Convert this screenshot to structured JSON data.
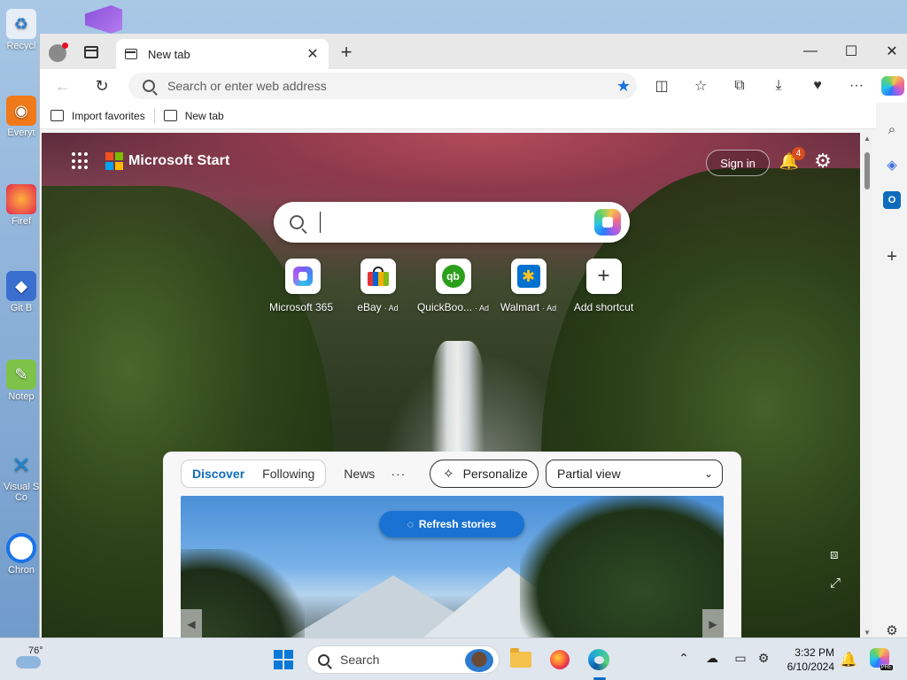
{
  "desktop": {
    "icons": [
      {
        "label": "Recycl",
        "icon": "recycle-bin-icon"
      },
      {
        "label": "Everyt",
        "icon": "everything-icon"
      },
      {
        "label": "Firef",
        "icon": "firefox-icon"
      },
      {
        "label": "Git B",
        "icon": "git-bash-icon"
      },
      {
        "label": "Notep",
        "icon": "notepad-icon"
      },
      {
        "label": "Visual S",
        "icon": "visual-studio-code-icon"
      },
      {
        "label": "Co",
        "icon": "vscode-label-icon"
      },
      {
        "label": "Chron",
        "icon": "chrome-icon"
      }
    ]
  },
  "browser": {
    "tab_title": "New tab",
    "address_placeholder": "Search or enter web address",
    "favorites_bar": {
      "import_label": "Import favorites",
      "new_tab_label": "New tab"
    },
    "window_controls": {
      "minimize": "—",
      "maximize": "☐",
      "close": "✕"
    }
  },
  "page": {
    "brand": "Microsoft Start",
    "sign_in": "Sign in",
    "notification_count": "4",
    "search_value": "",
    "shortcuts": [
      {
        "label": "Microsoft 365",
        "ad": "",
        "icon": "microsoft-365-icon"
      },
      {
        "label": "eBay",
        "ad": "· Ad",
        "icon": "ebay-icon"
      },
      {
        "label": "QuickBoo...",
        "ad": "· Ad",
        "icon": "quickbooks-icon"
      },
      {
        "label": "Walmart",
        "ad": "· Ad",
        "icon": "walmart-icon"
      },
      {
        "label": "Add shortcut",
        "ad": "",
        "icon": "plus-icon"
      }
    ],
    "feed": {
      "tabs": [
        {
          "label": "Discover",
          "active": true
        },
        {
          "label": "Following",
          "active": false
        }
      ],
      "news": "News",
      "more": "···",
      "personalize": "Personalize",
      "view_select": "Partial view",
      "refresh_button": "Refresh stories"
    }
  },
  "taskbar": {
    "weather_temp": "76°",
    "search_placeholder": "Search",
    "time": "3:32 PM",
    "date": "6/10/2024",
    "copilot_badge": "PRE"
  },
  "colors": {
    "accent": "#0f6cbd",
    "refresh_button": "#1a73d2",
    "notification_badge": "#d64d1f"
  }
}
